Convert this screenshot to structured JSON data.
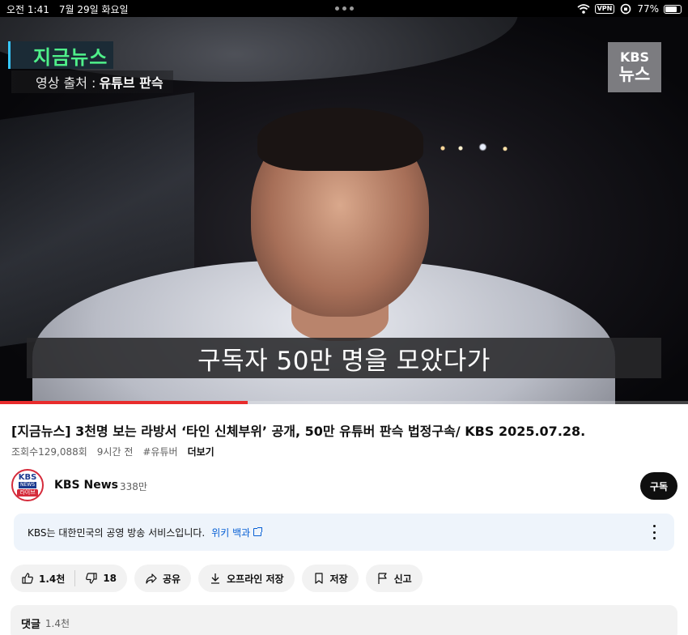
{
  "status_bar": {
    "time": "오전 1:41",
    "date": "7월 29일 화요일",
    "vpn": "VPN",
    "battery": "77%"
  },
  "video": {
    "corner_label": "지금뉴스",
    "source_prefix": "영상 출처 :",
    "source_name": "유튜브 판슥",
    "logo_line1": "KBS",
    "logo_line2": "뉴스",
    "subtitle": "구독자 50만 명을 모았다가",
    "progress_fraction": 0.36,
    "progress_color": "#e82c2c"
  },
  "details": {
    "title": "[지금뉴스] 3천명 보는 라방서 ‘타인 신체부위’ 공개, 50만 유튜버 판슥 법정구속/ KBS 2025.07.28.",
    "views": "조회수129,088회",
    "age": "9시간 전",
    "hashtag": "#유튜버",
    "more": "더보기"
  },
  "channel": {
    "avatar_line1": "KBS",
    "avatar_line2": "NEWS",
    "avatar_line3": "라이브",
    "name": "KBS News",
    "subscribers": "338만",
    "subscribe_label": "구독"
  },
  "info_box": {
    "text": "KBS는 대한민국의 공영 방송 서비스입니다.",
    "link": "위키 백과"
  },
  "actions": {
    "likes": "1.4천",
    "dislikes": "18",
    "share": "공유",
    "offline": "오프라인 저장",
    "save": "저장",
    "report": "신고"
  },
  "comments": {
    "label": "댓글",
    "count": "1.4천"
  },
  "colors": {
    "link": "#065fd4",
    "subscribe_bg": "#0f0f0f",
    "info_bg": "#eef4fb",
    "pill_bg": "#f2f2f2"
  }
}
